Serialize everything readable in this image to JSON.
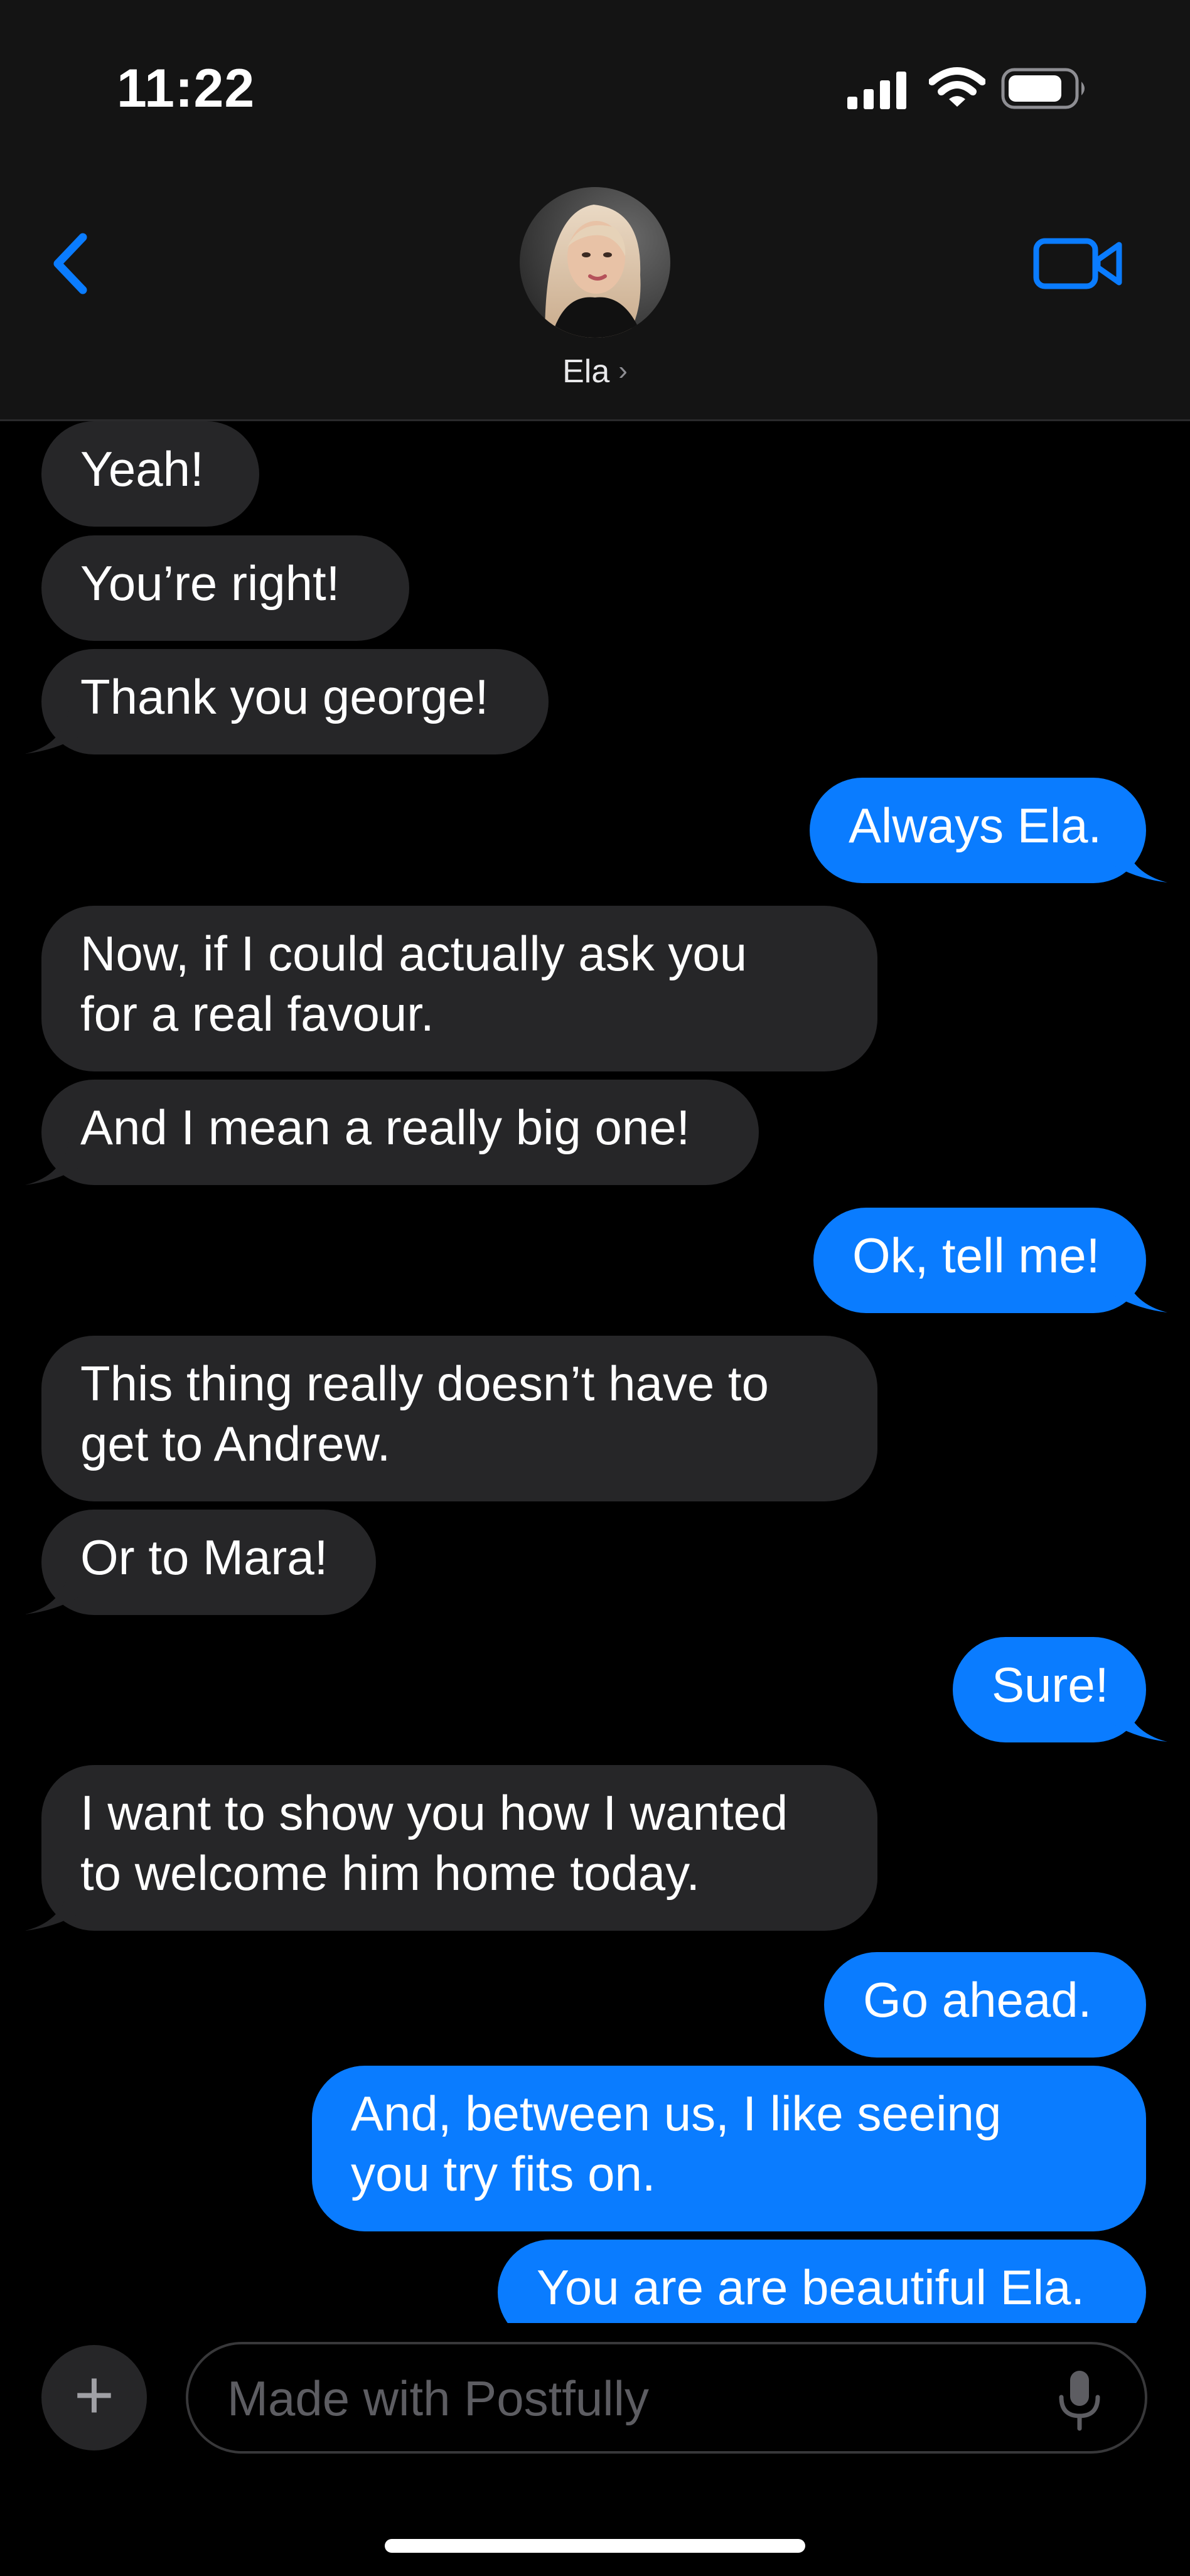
{
  "status_bar": {
    "time": "11:22",
    "signal_icon": "cellular-signal-icon",
    "wifi_icon": "wifi-icon",
    "battery_icon": "battery-icon"
  },
  "header": {
    "back_icon": "chevron-left-icon",
    "contact_name": "Ela",
    "contact_chevron": "›",
    "video_icon": "video-camera-icon"
  },
  "colors": {
    "incoming_bubble": "#262628",
    "outgoing_bubble": "#0a7cff",
    "accent": "#0a7cff",
    "background": "#000000",
    "header_background": "#141414"
  },
  "messages": [
    {
      "direction": "incoming",
      "text": [
        "Yeah!"
      ]
    },
    {
      "direction": "incoming",
      "text": [
        "You’re right!"
      ]
    },
    {
      "direction": "incoming",
      "text": [
        "Thank you george!"
      ]
    },
    {
      "direction": "outgoing",
      "text": [
        "Always Ela."
      ]
    },
    {
      "direction": "incoming",
      "text": [
        "Now, if I could actually ask you",
        "for a real favour."
      ]
    },
    {
      "direction": "incoming",
      "text": [
        "And I mean a really big one!"
      ]
    },
    {
      "direction": "outgoing",
      "text": [
        "Ok, tell me!"
      ]
    },
    {
      "direction": "incoming",
      "text": [
        "This thing really doesn’t have to",
        "get to Andrew."
      ]
    },
    {
      "direction": "incoming",
      "text": [
        "Or to Mara!"
      ]
    },
    {
      "direction": "outgoing",
      "text": [
        "Sure!"
      ]
    },
    {
      "direction": "incoming",
      "text": [
        "I want to show you how I wanted",
        "to welcome him home today."
      ]
    },
    {
      "direction": "outgoing",
      "text": [
        "Go ahead."
      ]
    },
    {
      "direction": "outgoing",
      "text": [
        "And, between us, I like seeing",
        "you try fits on."
      ]
    },
    {
      "direction": "outgoing",
      "text": [
        "You are are beautiful Ela."
      ]
    }
  ],
  "input_bar": {
    "plus_label": "+",
    "placeholder": "Made with Postfully",
    "mic_icon": "microphone-icon"
  }
}
